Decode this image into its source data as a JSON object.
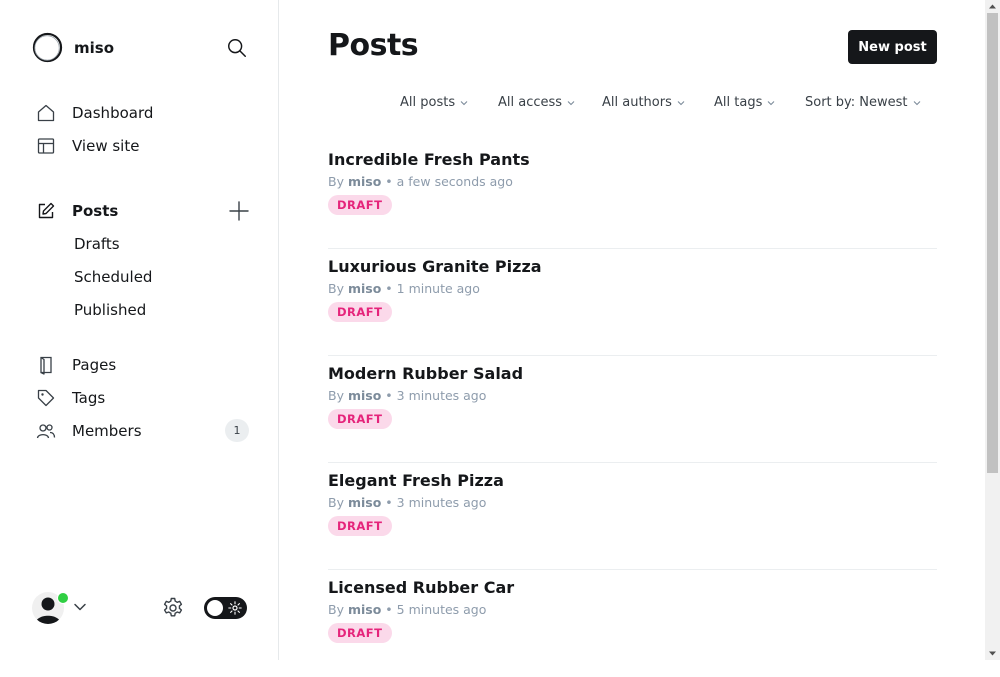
{
  "site": {
    "name": "miso"
  },
  "nav": {
    "dashboard": "Dashboard",
    "view_site": "View site",
    "posts": "Posts",
    "drafts": "Drafts",
    "scheduled": "Scheduled",
    "published": "Published",
    "pages": "Pages",
    "tags": "Tags",
    "members": "Members",
    "members_count": "1"
  },
  "main": {
    "title": "Posts",
    "new_post_label": "New post",
    "filters": {
      "type": "All posts",
      "access": "All access",
      "authors": "All authors",
      "tags": "All tags",
      "sort": "Sort by: Newest"
    },
    "posts": [
      {
        "title": "Incredible Fresh Pants",
        "by": "By",
        "author": "miso",
        "time": "• a few seconds ago",
        "status": "DRAFT"
      },
      {
        "title": "Luxurious Granite Pizza",
        "by": "By",
        "author": "miso",
        "time": "• 1 minute ago",
        "status": "DRAFT"
      },
      {
        "title": "Modern Rubber Salad",
        "by": "By",
        "author": "miso",
        "time": "• 3 minutes ago",
        "status": "DRAFT"
      },
      {
        "title": "Elegant Fresh Pizza",
        "by": "By",
        "author": "miso",
        "time": "• 3 minutes ago",
        "status": "DRAFT"
      },
      {
        "title": "Licensed Rubber Car",
        "by": "By",
        "author": "miso",
        "time": "• 5 minutes ago",
        "status": "DRAFT"
      }
    ]
  },
  "colors": {
    "accent_dark": "#15171a",
    "draft_badge_bg": "#fbd9ea",
    "draft_badge_text": "#e5247b",
    "online_indicator": "#30cf43"
  },
  "icons": {
    "logo": "ghost-ring-logo-icon",
    "search": "search-icon",
    "dashboard": "home-icon",
    "view_site": "layout-icon",
    "posts": "edit-icon",
    "add": "plus-icon",
    "pages": "page-icon",
    "tags": "tag-icon",
    "members": "users-icon",
    "settings": "gear-icon",
    "theme": "sun-icon"
  }
}
